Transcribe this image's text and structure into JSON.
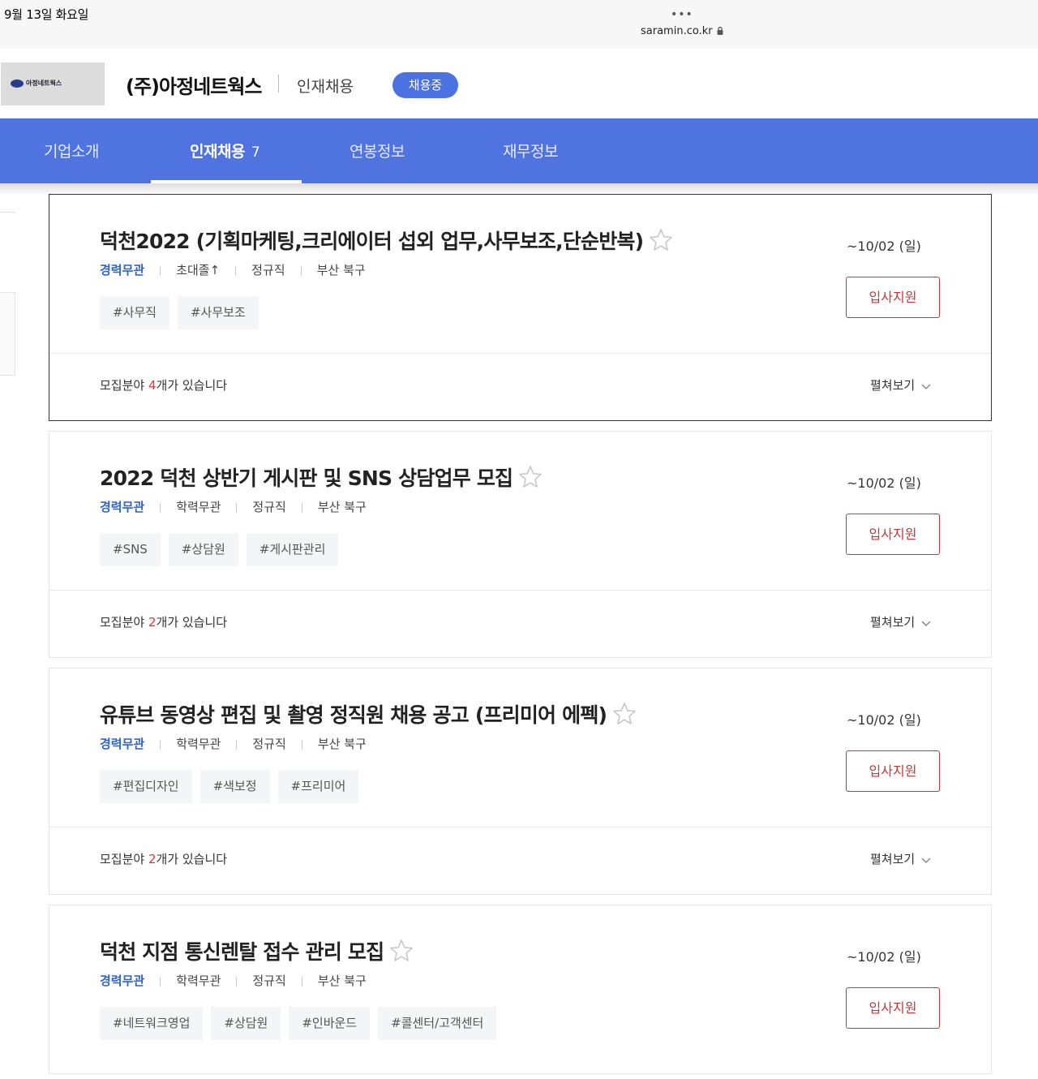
{
  "status_bar": {
    "date": "9월 13일 화요일",
    "dots": "•••",
    "url": "saramin.co.kr"
  },
  "company": {
    "logo_text": "아정네트웍스",
    "name": "(주)아정네트웍스",
    "subtitle": "인재채용",
    "badge": "채용중"
  },
  "nav": {
    "tabs": [
      {
        "label": "기업소개"
      },
      {
        "label": "인재채용",
        "count": "7"
      },
      {
        "label": "연봉정보"
      },
      {
        "label": "재무정보"
      }
    ],
    "active_index": 1,
    "accent_color": "#4f73df"
  },
  "jobs": [
    {
      "title": "덕천2022 (기획마케팅,크리에이터 섭외 업무,사무보조,단순반복)",
      "career": "경력무관",
      "education": "초대졸↑",
      "employment": "정규직",
      "location": "부산 북구",
      "tags": [
        "#사무직",
        "#사무보조"
      ],
      "deadline": "~10/02 (일)",
      "apply_label": "입사지원",
      "fields_prefix": "모집분야 ",
      "fields_count": "4",
      "fields_suffix": "개가 있습니다",
      "expand_label": "펼쳐보기"
    },
    {
      "title": "2022 덕천 상반기 게시판 및 SNS 상담업무 모집",
      "career": "경력무관",
      "education": "학력무관",
      "employment": "정규직",
      "location": "부산 북구",
      "tags": [
        "#SNS",
        "#상담원",
        "#게시판관리"
      ],
      "deadline": "~10/02 (일)",
      "apply_label": "입사지원",
      "fields_prefix": "모집분야 ",
      "fields_count": "2",
      "fields_suffix": "개가 있습니다",
      "expand_label": "펼쳐보기"
    },
    {
      "title": "유튜브 동영상 편집 및 촬영 정직원 채용 공고 (프리미어 에펙)",
      "career": "경력무관",
      "education": "학력무관",
      "employment": "정규직",
      "location": "부산 북구",
      "tags": [
        "#편집디자인",
        "#색보정",
        "#프리미어"
      ],
      "deadline": "~10/02 (일)",
      "apply_label": "입사지원",
      "fields_prefix": "모집분야 ",
      "fields_count": "2",
      "fields_suffix": "개가 있습니다",
      "expand_label": "펼쳐보기"
    },
    {
      "title": "덕천 지점 통신렌탈 접수 관리 모집",
      "career": "경력무관",
      "education": "학력무관",
      "employment": "정규직",
      "location": "부산 북구",
      "tags": [
        "#네트워크영업",
        "#상담원",
        "#인바운드",
        "#콜센터/고객센터"
      ],
      "deadline": "~10/02 (일)",
      "apply_label": "입사지원"
    }
  ]
}
